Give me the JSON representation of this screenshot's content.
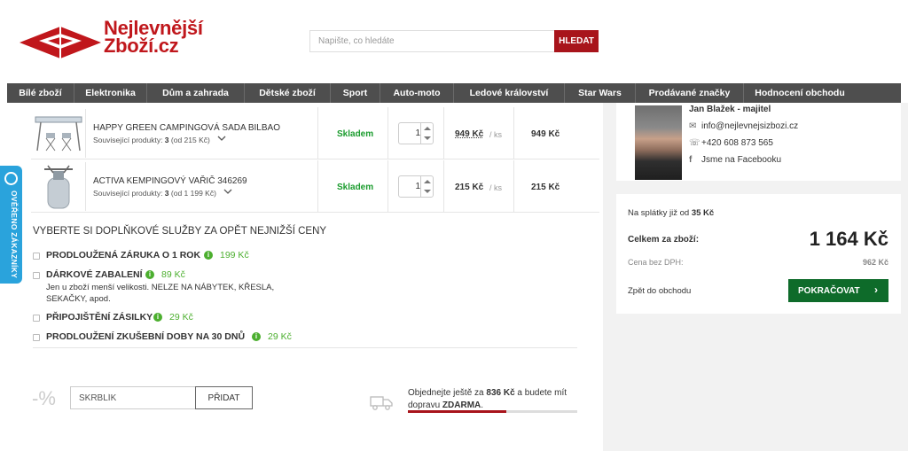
{
  "header": {
    "logo_line1": "Nejlevnější",
    "logo_line2": "Zboží.cz",
    "search_placeholder": "Napište, co hledáte",
    "search_button": "HLEDAT",
    "brand_color": "#c0171c"
  },
  "nav": {
    "items": [
      {
        "label": "Bílé zboží"
      },
      {
        "label": "Elektronika"
      },
      {
        "label": "Dům a zahrada"
      },
      {
        "label": "Dětské zboží"
      },
      {
        "label": "Sport"
      },
      {
        "label": "Auto-moto"
      },
      {
        "label": "Ledové království"
      },
      {
        "label": "Star Wars"
      },
      {
        "label": "Prodávané značky"
      },
      {
        "label": "Hodnocení obchodu"
      }
    ]
  },
  "side_badge": {
    "label": "OVĚŘENO ZÁKAZNÍKY"
  },
  "cart": {
    "items": [
      {
        "name": "HAPPY GREEN CAMPINGOVÁ SADA BILBAO",
        "related_prefix": "Související produkty: ",
        "related_count": "3",
        "related_suffix": " (od 215 Kč)",
        "stock": "Skladem",
        "qty": "1",
        "unit_price": "949 Kč",
        "per": "/ ks",
        "total": "949 Kč"
      },
      {
        "name": "ACTIVA KEMPINGOVÝ VAŘIČ 346269",
        "related_prefix": "Související produkty: ",
        "related_count": "3",
        "related_suffix": " (od 1 199 Kč)",
        "stock": "Skladem",
        "qty": "1",
        "unit_price": "215 Kč",
        "per": "/ ks",
        "total": "215 Kč"
      }
    ]
  },
  "services": {
    "title": "VYBERTE SI DOPLŇKOVÉ SLUŽBY ZA OPĚT NEJNIŽŠÍ CENY",
    "items": [
      {
        "label": "PRODLOUŽENÁ ZÁRUKA O 1 ROK",
        "price": "199 Kč",
        "desc": ""
      },
      {
        "label": "DÁRKOVÉ ZABALENÍ",
        "price": "89 Kč",
        "desc": "Jen u zboží menší velikosti. NELZE NA NÁBYTEK, KŘESLA, SEKAČKY, apod."
      },
      {
        "label": "PŘIPOJIŠTĚNÍ ZÁSILKY",
        "price": "29 Kč",
        "desc": ""
      },
      {
        "label": "PRODLOUŽENÍ ZKUŠEBNÍ DOBY NA 30 DNŮ",
        "price": "29 Kč",
        "desc": ""
      }
    ]
  },
  "coupon": {
    "symbol": "-%",
    "value": "SKRBLÍK",
    "button": "PŘIDAT"
  },
  "shipping": {
    "text_before": "Objednejte ještě za ",
    "amount": "836 Kč",
    "text_middle": " a budete mít dopravu ",
    "free": "ZDARMA",
    "text_end": ".",
    "progress": 0.58
  },
  "contact": {
    "name": "Jan Blažek - majitel",
    "email": "info@nejlevnejsizbozi.cz",
    "phone": "+420 608 873 565",
    "facebook": "Jsme na Facebooku"
  },
  "summary": {
    "installments_prefix": "Na splátky již od ",
    "installments_value": "35 Kč",
    "total_label": "Celkem za zboží:",
    "total_value": "1 164 Kč",
    "net_label": "Cena bez DPH:",
    "net_value": "962 Kč",
    "back_label": "Zpět do obchodu",
    "continue_label": "POKRAČOVAT",
    "continue_color": "#0e6b2a"
  }
}
